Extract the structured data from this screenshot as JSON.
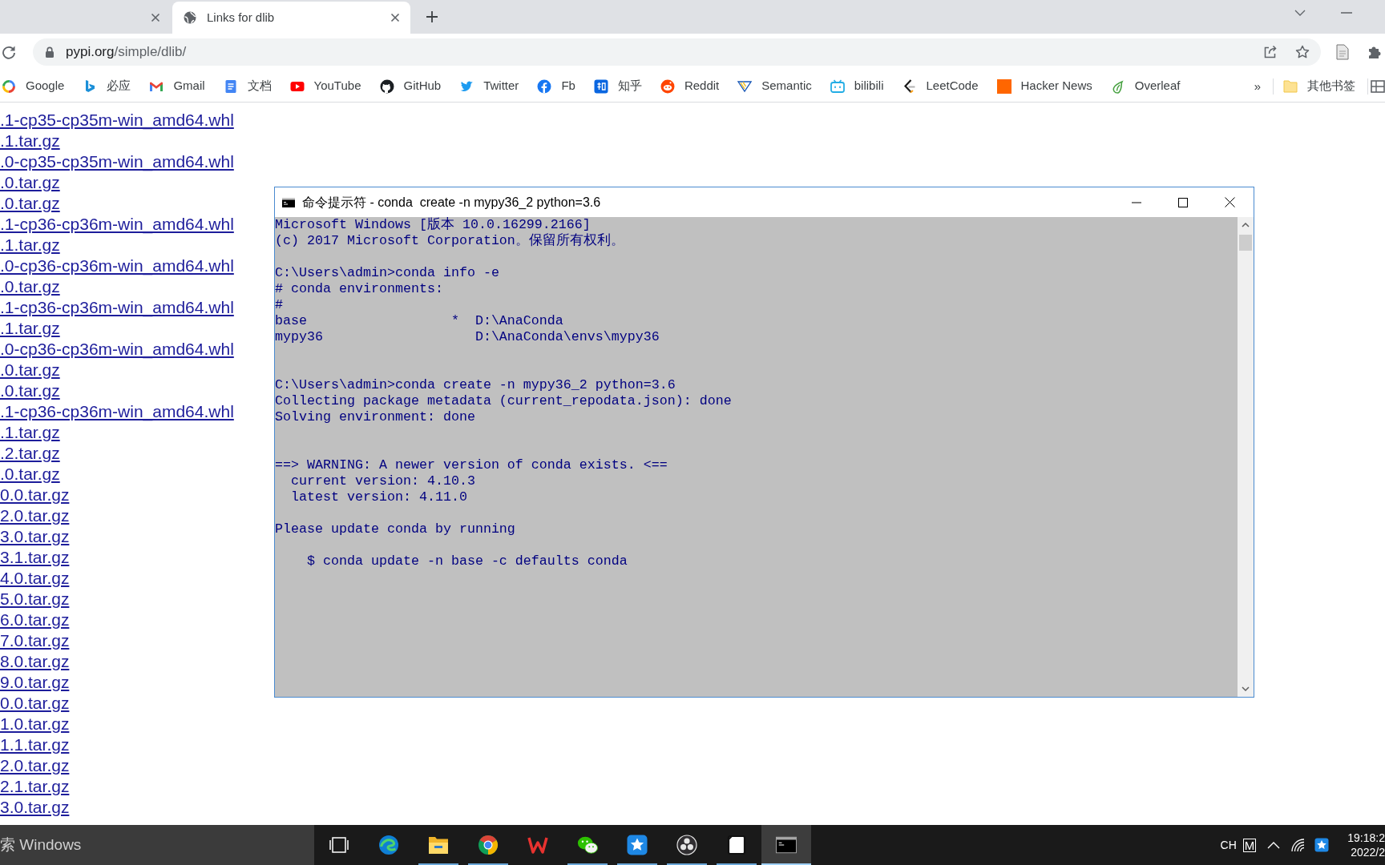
{
  "browser": {
    "tabs": [
      {
        "selected": false
      },
      {
        "title": "Links for dlib",
        "selected": true
      }
    ],
    "url": "pypi.org/simple/dlib/",
    "bookmarks": [
      {
        "label": "Google"
      },
      {
        "label": "必应"
      },
      {
        "label": "Gmail"
      },
      {
        "label": "文档"
      },
      {
        "label": "YouTube"
      },
      {
        "label": "GitHub"
      },
      {
        "label": "Twitter"
      },
      {
        "label": "Fb"
      },
      {
        "label": "知乎"
      },
      {
        "label": "Reddit"
      },
      {
        "label": "Semantic"
      },
      {
        "label": "bilibili"
      },
      {
        "label": "LeetCode"
      },
      {
        "label": "Hacker News"
      },
      {
        "label": "Overleaf"
      }
    ],
    "more": "»",
    "other_bookmarks": "其他书签"
  },
  "page": {
    "links": [
      ".1-cp35-cp35m-win_amd64.whl",
      ".1.tar.gz",
      ".0-cp35-cp35m-win_amd64.whl",
      ".0.tar.gz",
      ".0.tar.gz",
      ".1-cp36-cp36m-win_amd64.whl",
      ".1.tar.gz",
      ".0-cp36-cp36m-win_amd64.whl",
      ".0.tar.gz",
      ".1-cp36-cp36m-win_amd64.whl",
      ".1.tar.gz",
      ".0-cp36-cp36m-win_amd64.whl",
      ".0.tar.gz",
      ".0.tar.gz",
      ".1-cp36-cp36m-win_amd64.whl",
      ".1.tar.gz",
      ".2.tar.gz",
      ".0.tar.gz",
      "0.0.tar.gz",
      "2.0.tar.gz",
      "3.0.tar.gz",
      "3.1.tar.gz",
      "4.0.tar.gz",
      "5.0.tar.gz",
      "6.0.tar.gz",
      "7.0.tar.gz",
      "8.0.tar.gz",
      "9.0.tar.gz",
      "0.0.tar.gz",
      "1.0.tar.gz",
      "1.1.tar.gz",
      "2.0.tar.gz",
      "2.1.tar.gz",
      "3.0.tar.gz"
    ]
  },
  "console": {
    "title": "命令提示符 - conda  create -n mypy36_2 python=3.6",
    "output": "Microsoft Windows [版本 10.0.16299.2166]\n(c) 2017 Microsoft Corporation。保留所有权利。\n\nC:\\Users\\admin>conda info -e\n# conda environments:\n#\nbase                  *  D:\\AnaConda\nmypy36                   D:\\AnaConda\\envs\\mypy36\n\n\nC:\\Users\\admin>conda create -n mypy36_2 python=3.6\nCollecting package metadata (current_repodata.json): done\nSolving environment: done\n\n\n==> WARNING: A newer version of conda exists. <==\n  current version: 4.10.3\n  latest version: 4.11.0\n\nPlease update conda by running\n\n    $ conda update -n base -c defaults conda"
  },
  "taskbar": {
    "search": {
      "placeholder": "索 Windows"
    },
    "apps": [
      {
        "running": false,
        "active": false
      },
      {
        "running": true,
        "active": false
      },
      {
        "running": true,
        "active": false
      },
      {
        "running": false,
        "active": false
      },
      {
        "running": true,
        "active": false
      },
      {
        "running": true,
        "active": false
      },
      {
        "running": true,
        "active": false
      },
      {
        "running": true,
        "active": false
      },
      {
        "running": true,
        "active": true
      }
    ],
    "tray": {
      "language": "CH",
      "ime": "M",
      "time": "19:18:2",
      "date": "2022/2"
    }
  }
}
